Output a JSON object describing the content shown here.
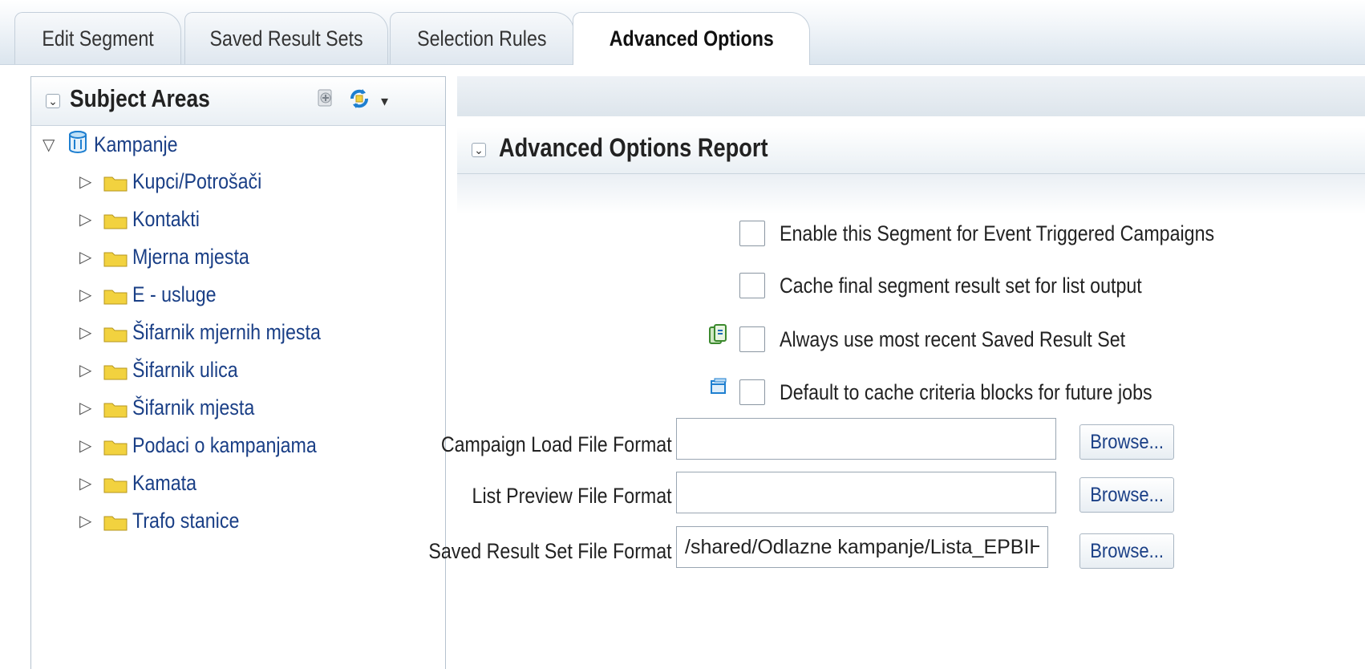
{
  "tabs": [
    {
      "label": "Edit Segment"
    },
    {
      "label": "Saved Result Sets"
    },
    {
      "label": "Selection Rules"
    },
    {
      "label": "Advanced Options"
    }
  ],
  "active_tab": "Advanced Options",
  "subject_areas": {
    "title": "Subject Areas",
    "root": "Kampanje",
    "folders": [
      {
        "label": "Kupci/Potrošači"
      },
      {
        "label": "Kontakti"
      },
      {
        "label": "Mjerna mjesta"
      },
      {
        "label": "E - usluge"
      },
      {
        "label": "Šifarnik mjernih mjesta"
      },
      {
        "label": "Šifarnik ulica"
      },
      {
        "label": "Šifarnik mjesta"
      },
      {
        "label": "Podaci o kampanjama"
      },
      {
        "label": "Kamata"
      },
      {
        "label": "Trafo stanice"
      }
    ]
  },
  "report": {
    "title": "Advanced Options Report",
    "options": [
      {
        "label": "Enable this Segment for Event Triggered Campaigns",
        "checked": false
      },
      {
        "label": "Cache final segment result set for list output",
        "checked": false
      },
      {
        "label": "Always use most recent Saved Result Set",
        "checked": false
      },
      {
        "label": "Default to cache criteria blocks for future jobs",
        "checked": false
      }
    ],
    "fields": [
      {
        "label": "Campaign Load File Format",
        "value": ""
      },
      {
        "label": "List Preview File Format",
        "value": ""
      },
      {
        "label": "Saved Result Set File Format",
        "value": "/shared/Odlazne kampanje/Lista_EPBIH"
      }
    ],
    "browse_label": "Browse..."
  },
  "colors": {
    "link": "#1a3f86",
    "folder": "#f2d23f",
    "accent": "#1e7fd0"
  }
}
